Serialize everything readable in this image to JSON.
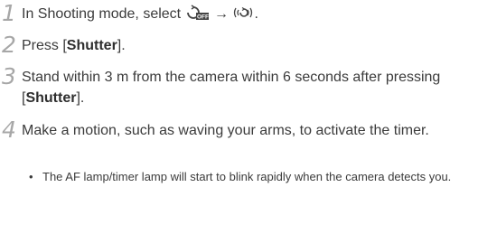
{
  "steps": [
    {
      "number": "1",
      "before": "In Shooting mode, select ",
      "arrow": "→",
      "after": "."
    },
    {
      "number": "2",
      "prefix": "Press [",
      "bold": "Shutter",
      "suffix": "]."
    },
    {
      "number": "3",
      "prefix": "Stand within 3 m from the camera within 6 seconds after pressing [",
      "bold": "Shutter",
      "suffix": "]."
    },
    {
      "number": "4",
      "text": "Make a motion, such as waving your arms, to activate the timer."
    }
  ],
  "bullet": {
    "mark": "•",
    "text": "The AF lamp/timer lamp will start to blink rapidly when the camera detects you."
  },
  "icons": {
    "timer_off": "timer-off-icon",
    "motion_timer": "motion-timer-icon"
  },
  "icon_badge": "OFF"
}
